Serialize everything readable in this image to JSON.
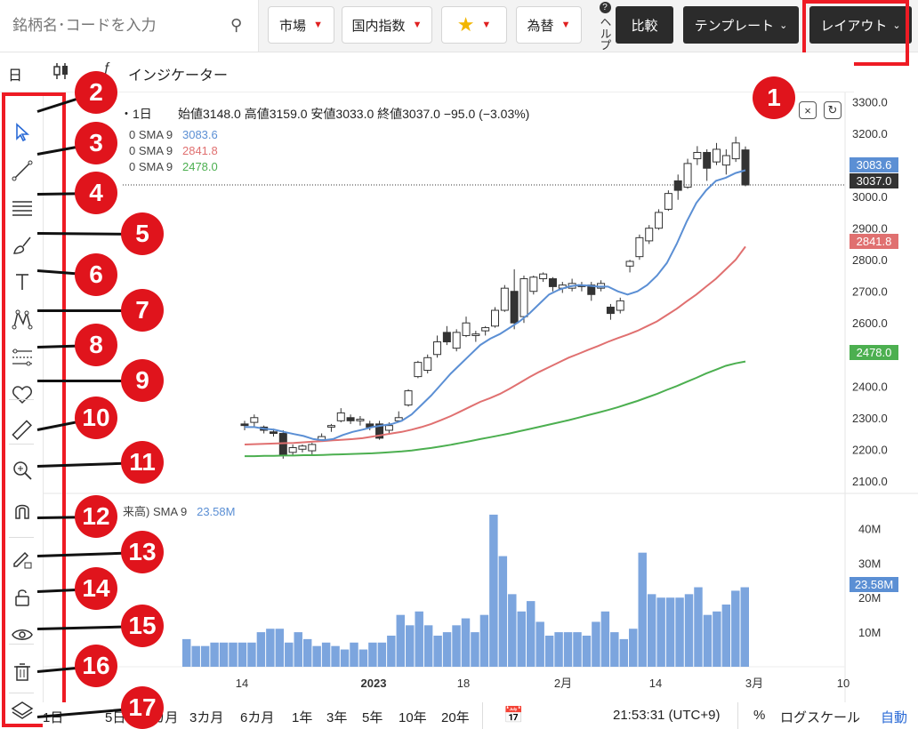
{
  "search": {
    "placeholder": "銘柄名･コードを入力"
  },
  "nav": {
    "market": "市場",
    "domestic_index": "国内指数",
    "fx": "為替",
    "help": "ヘルプ",
    "compare": "比較",
    "template": "テンプレート",
    "layout": "レイアウト"
  },
  "toolbar2": {
    "interval": "日",
    "indicators": "インジケーター"
  },
  "info": {
    "interval": "・1日",
    "ohlc": "始値3148.0 高値3159.0 安値3033.0 終値3037.0 −95.0 (−3.03%)",
    "sma_label": "0 SMA 9",
    "volume_label": "来高) SMA 9",
    "volume_sma": "23.58M"
  },
  "sma_lines": [
    {
      "label": "0 SMA 9",
      "value": "3083.6",
      "color": "#5b8fd4"
    },
    {
      "label": "0 SMA 9",
      "value": "2841.8",
      "color": "#e07070"
    },
    {
      "label": "0 SMA 9",
      "value": "2478.0",
      "color": "#4caf50"
    }
  ],
  "price_tags": [
    {
      "value": "3083.6",
      "color": "#5b8fd4"
    },
    {
      "value": "3037.0",
      "color": "#333333"
    },
    {
      "value": "2841.8",
      "color": "#e07070"
    },
    {
      "value": "2478.0",
      "color": "#4caf50"
    },
    {
      "value": "23.58M",
      "color": "#5b8fd4"
    }
  ],
  "tools": [
    "cursor-icon",
    "trendline-icon",
    "horizontal-lines-icon",
    "brush-icon",
    "text-icon",
    "pattern-icon",
    "fib-icon",
    "heart-icon",
    "ruler-icon",
    "zoom-in-icon",
    "magnet-icon",
    "lock-pencil-icon",
    "unlock-icon",
    "eye-icon",
    "trash-icon",
    "layers-icon"
  ],
  "badges": [
    "1",
    "2",
    "3",
    "4",
    "5",
    "6",
    "7",
    "8",
    "9",
    "10",
    "11",
    "12",
    "13",
    "14",
    "15",
    "16",
    "17"
  ],
  "bottom": {
    "ranges": [
      "1日",
      "5日",
      "1カ月",
      "3カ月",
      "6カ月",
      "1年",
      "3年",
      "5年",
      "10年",
      "20年"
    ],
    "time": "21:53:31 (UTC+9)",
    "percent": "%",
    "log": "ログスケール",
    "auto": "自動"
  },
  "chart_data": {
    "type": "candlestick",
    "price_axis": {
      "ticks": [
        3300,
        3200,
        3100,
        3000,
        2900,
        2800,
        2700,
        2600,
        2500,
        2400,
        2300,
        2200,
        2100
      ],
      "ylim": [
        2060,
        3330
      ]
    },
    "volume_axis": {
      "ticks": [
        "40M",
        "30M",
        "20M",
        "10M"
      ],
      "ylim": [
        0,
        45
      ]
    },
    "x_ticks": [
      "14",
      "2023",
      "18",
      "2月",
      "14",
      "3月",
      "10"
    ],
    "candles": [
      [
        2280,
        2290,
        2260,
        2275
      ],
      [
        2285,
        2310,
        2270,
        2300
      ],
      [
        2270,
        2275,
        2250,
        2260
      ],
      [
        2255,
        2265,
        2240,
        2250
      ],
      [
        2250,
        2260,
        2170,
        2180
      ],
      [
        2190,
        2215,
        2180,
        2205
      ],
      [
        2200,
        2215,
        2190,
        2210
      ],
      [
        2195,
        2220,
        2180,
        2215
      ],
      [
        2230,
        2250,
        2225,
        2240
      ],
      [
        2270,
        2280,
        2255,
        2275
      ],
      [
        2290,
        2330,
        2285,
        2315
      ],
      [
        2300,
        2310,
        2280,
        2290
      ],
      [
        2290,
        2305,
        2275,
        2295
      ],
      [
        2280,
        2290,
        2260,
        2270
      ],
      [
        2280,
        2290,
        2230,
        2235
      ],
      [
        2260,
        2285,
        2250,
        2275
      ],
      [
        2290,
        2320,
        2285,
        2300
      ],
      [
        2340,
        2390,
        2335,
        2385
      ],
      [
        2430,
        2480,
        2425,
        2475
      ],
      [
        2450,
        2500,
        2440,
        2490
      ],
      [
        2500,
        2560,
        2490,
        2540
      ],
      [
        2570,
        2590,
        2530,
        2540
      ],
      [
        2520,
        2580,
        2510,
        2570
      ],
      [
        2560,
        2620,
        2555,
        2600
      ],
      [
        2560,
        2575,
        2540,
        2565
      ],
      [
        2575,
        2590,
        2560,
        2585
      ],
      [
        2590,
        2650,
        2585,
        2640
      ],
      [
        2640,
        2720,
        2635,
        2710
      ],
      [
        2700,
        2770,
        2580,
        2600
      ],
      [
        2620,
        2750,
        2600,
        2740
      ],
      [
        2700,
        2750,
        2690,
        2745
      ],
      [
        2740,
        2760,
        2730,
        2755
      ],
      [
        2740,
        2745,
        2700,
        2715
      ],
      [
        2710,
        2730,
        2695,
        2720
      ],
      [
        2710,
        2740,
        2700,
        2725
      ],
      [
        2720,
        2730,
        2700,
        2715
      ],
      [
        2720,
        2730,
        2670,
        2690
      ],
      [
        2710,
        2735,
        2700,
        2725
      ],
      [
        2650,
        2660,
        2610,
        2630
      ],
      [
        2640,
        2680,
        2630,
        2670
      ],
      [
        2780,
        2800,
        2760,
        2795
      ],
      [
        2810,
        2880,
        2800,
        2870
      ],
      [
        2860,
        2910,
        2850,
        2900
      ],
      [
        2900,
        2960,
        2895,
        2950
      ],
      [
        2960,
        3020,
        2955,
        3010
      ],
      [
        3050,
        3070,
        2990,
        3020
      ],
      [
        3030,
        3120,
        3025,
        3105
      ],
      [
        3120,
        3160,
        3100,
        3140
      ],
      [
        3140,
        3150,
        3050,
        3090
      ],
      [
        3110,
        3170,
        3100,
        3150
      ],
      [
        3100,
        3150,
        3070,
        3130
      ],
      [
        3120,
        3190,
        3110,
        3170
      ],
      [
        3148,
        3159,
        3033,
        3037
      ]
    ],
    "sma_fast": [
      2270,
      2270,
      2265,
      2262,
      2255,
      2248,
      2242,
      2232,
      2228,
      2232,
      2245,
      2255,
      2262,
      2270,
      2275,
      2280,
      2290,
      2310,
      2340,
      2370,
      2405,
      2440,
      2470,
      2500,
      2530,
      2550,
      2565,
      2585,
      2605,
      2630,
      2660,
      2690,
      2705,
      2715,
      2720,
      2718,
      2715,
      2715,
      2700,
      2690,
      2700,
      2720,
      2750,
      2790,
      2850,
      2920,
      2980,
      3020,
      3050,
      3060,
      3075,
      3083.6
    ],
    "sma_mid": [
      2215,
      2216,
      2217,
      2218,
      2219,
      2220,
      2222,
      2224,
      2226,
      2228,
      2230,
      2232,
      2235,
      2240,
      2245,
      2250,
      2255,
      2262,
      2270,
      2280,
      2292,
      2305,
      2320,
      2335,
      2350,
      2362,
      2375,
      2392,
      2410,
      2428,
      2445,
      2460,
      2475,
      2490,
      2502,
      2515,
      2527,
      2540,
      2552,
      2563,
      2575,
      2590,
      2605,
      2625,
      2645,
      2668,
      2690,
      2715,
      2740,
      2770,
      2800,
      2841.8
    ],
    "sma_slow": [
      2178,
      2178,
      2179,
      2179,
      2180,
      2180,
      2181,
      2181,
      2182,
      2183,
      2184,
      2185,
      2186,
      2187,
      2189,
      2191,
      2193,
      2196,
      2200,
      2204,
      2209,
      2214,
      2220,
      2226,
      2232,
      2238,
      2244,
      2250,
      2257,
      2264,
      2271,
      2278,
      2285,
      2292,
      2300,
      2308,
      2316,
      2324,
      2333,
      2343,
      2353,
      2364,
      2375,
      2388,
      2400,
      2413,
      2426,
      2440,
      2452,
      2464,
      2472,
      2478.0
    ],
    "volumes": [
      8,
      6,
      6,
      7,
      7,
      7,
      7,
      7,
      10,
      11,
      11,
      7,
      10,
      8,
      6,
      7,
      6,
      5,
      7,
      5,
      7,
      7,
      9,
      15,
      12,
      16,
      12,
      9,
      10,
      12,
      14,
      10,
      15,
      44,
      32,
      21,
      16,
      19,
      13,
      9,
      10,
      10,
      10,
      9,
      13,
      16,
      10,
      8,
      11,
      33,
      21,
      20,
      20,
      20,
      21,
      23,
      15,
      16,
      18,
      22,
      23
    ]
  }
}
